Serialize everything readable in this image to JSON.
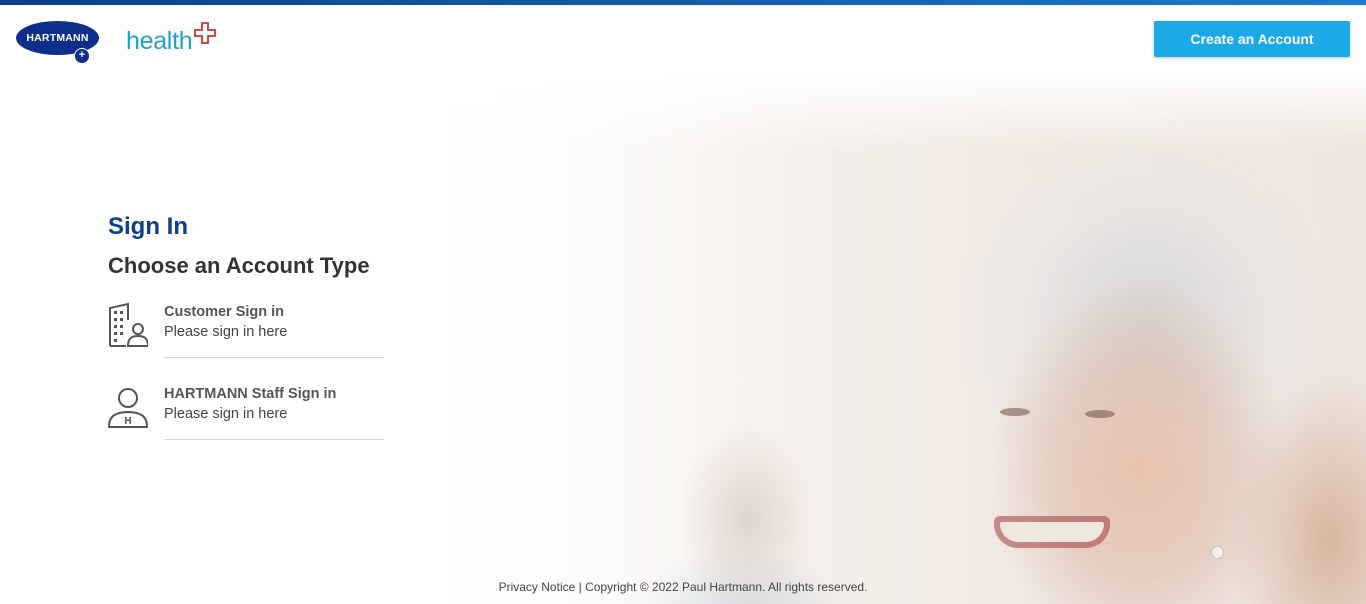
{
  "header": {
    "brand_logo_text": "HARTMANN",
    "product_logo_text": "health",
    "create_account_label": "Create an Account"
  },
  "signin": {
    "title": "Sign In",
    "subtitle": "Choose an Account Type",
    "options": [
      {
        "label": "Customer Sign in",
        "sub": "Please sign in here",
        "icon": "building-person-icon"
      },
      {
        "label": "HARTMANN Staff Sign in",
        "sub": "Please sign in here",
        "icon": "staff-person-icon"
      }
    ]
  },
  "footer": {
    "privacy_label": "Privacy Notice",
    "separator": "|",
    "copyright": "Copyright © 2022 Paul Hartmann. All rights reserved."
  },
  "colors": {
    "accent": "#1ba9e8",
    "brand_navy": "#0d2e8a",
    "title_blue": "#0d3f8a",
    "health_teal": "#1ea2c7",
    "cross_red": "#d0342c"
  }
}
